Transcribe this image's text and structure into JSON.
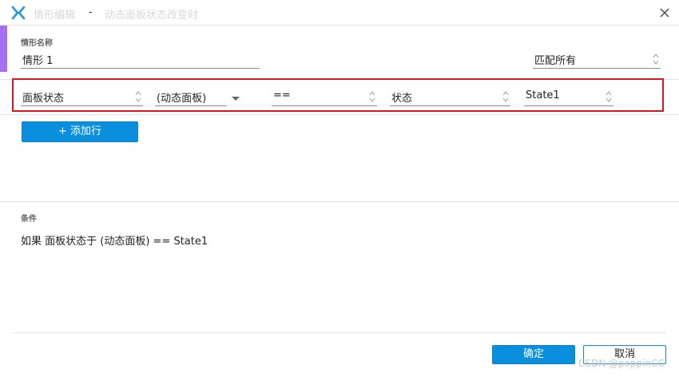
{
  "window": {
    "title": "情形编辑",
    "separator": "-",
    "subtitle": "动态面板状态改变时",
    "logo_icon": "axure-x-logo",
    "close_icon": "close-icon"
  },
  "case": {
    "label": "情形名称",
    "name_value": "情形 1",
    "match_value": "匹配所有"
  },
  "condition_row": {
    "target_type": "面板状态",
    "target_value": "(动态面板)",
    "operator": "==",
    "compare_type": "状态",
    "compare_value": "State1"
  },
  "add_row_label": "+ 添加行",
  "condition": {
    "label": "条件",
    "text": "如果  面板状态于 (动态面板) == State1"
  },
  "footer": {
    "ok_label": "确定",
    "cancel_label": "取消"
  },
  "watermark": "CSDN @poppinCC",
  "colors": {
    "accent": "#a66ef0",
    "primary": "#0a8fde",
    "highlight_border": "#e0141e"
  }
}
